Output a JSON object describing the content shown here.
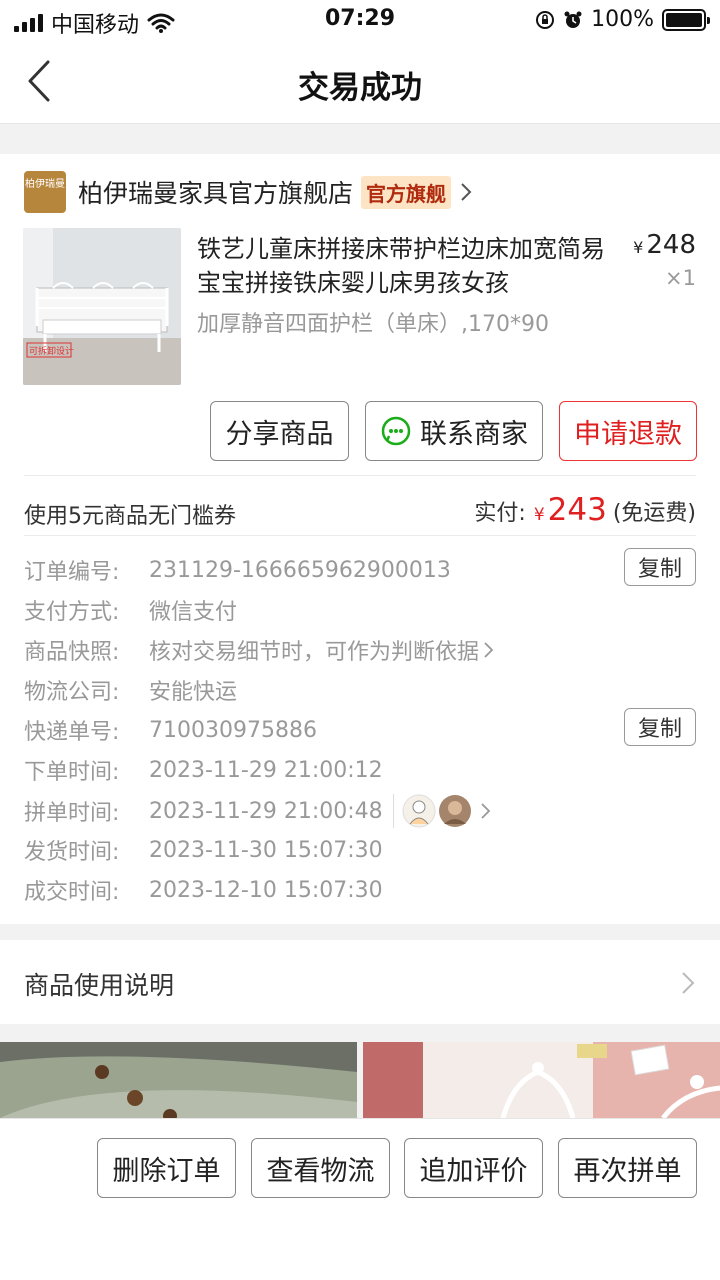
{
  "status": {
    "carrier": "中国移动",
    "time": "07:29",
    "battery": "100%",
    "battery_level": 1.0
  },
  "nav": {
    "title": "交易成功"
  },
  "store": {
    "logo_text": "柏伊瑞曼",
    "name": "柏伊瑞曼家具官方旗舰店",
    "badge": "官方旗舰"
  },
  "product": {
    "title": "铁艺儿童床拼接床带护栏边床加宽简易宝宝拼接铁床婴儿床男孩女孩",
    "spec": "加厚静音四面护栏（单床）,170*90",
    "price_symbol": "¥",
    "price": "248",
    "qty": "×1",
    "image_caption": "可拆卸设计"
  },
  "actions": {
    "share": "分享商品",
    "contact": "联系商家",
    "refund": "申请退款"
  },
  "summary": {
    "coupon": "使用5元商品无门槛券",
    "paid_label": "实付:",
    "paid_symbol": "¥",
    "paid_amount": "243",
    "shipping": "(免运费)"
  },
  "details": {
    "order_no": {
      "label": "订单编号:",
      "value": "231129-166665962900013"
    },
    "payment": {
      "label": "支付方式:",
      "value": "微信支付"
    },
    "snapshot": {
      "label": "商品快照:",
      "value": "核对交易细节时，可作为判断依据"
    },
    "logistics": {
      "label": "物流公司:",
      "value": "安能快运"
    },
    "tracking": {
      "label": "快递单号:",
      "value": "710030975886"
    },
    "ordered": {
      "label": "下单时间:",
      "value": "2023-11-29 21:00:12"
    },
    "grouped": {
      "label": "拼单时间:",
      "value": "2023-11-29 21:00:48"
    },
    "shipped": {
      "label": "发货时间:",
      "value": "2023-11-30 15:07:30"
    },
    "completed": {
      "label": "成交时间:",
      "value": "2023-12-10 15:07:30"
    },
    "copy": "复制"
  },
  "usage": {
    "label": "商品使用说明"
  },
  "bottom": {
    "delete": "删除订单",
    "logistics": "查看物流",
    "review": "追加评价",
    "regroup": "再次拼单"
  },
  "colors": {
    "accent_red": "#e02020",
    "wechat_green": "#1aad19",
    "badge_bg": "#fde4c5",
    "logo_gold": "#b7863d"
  }
}
